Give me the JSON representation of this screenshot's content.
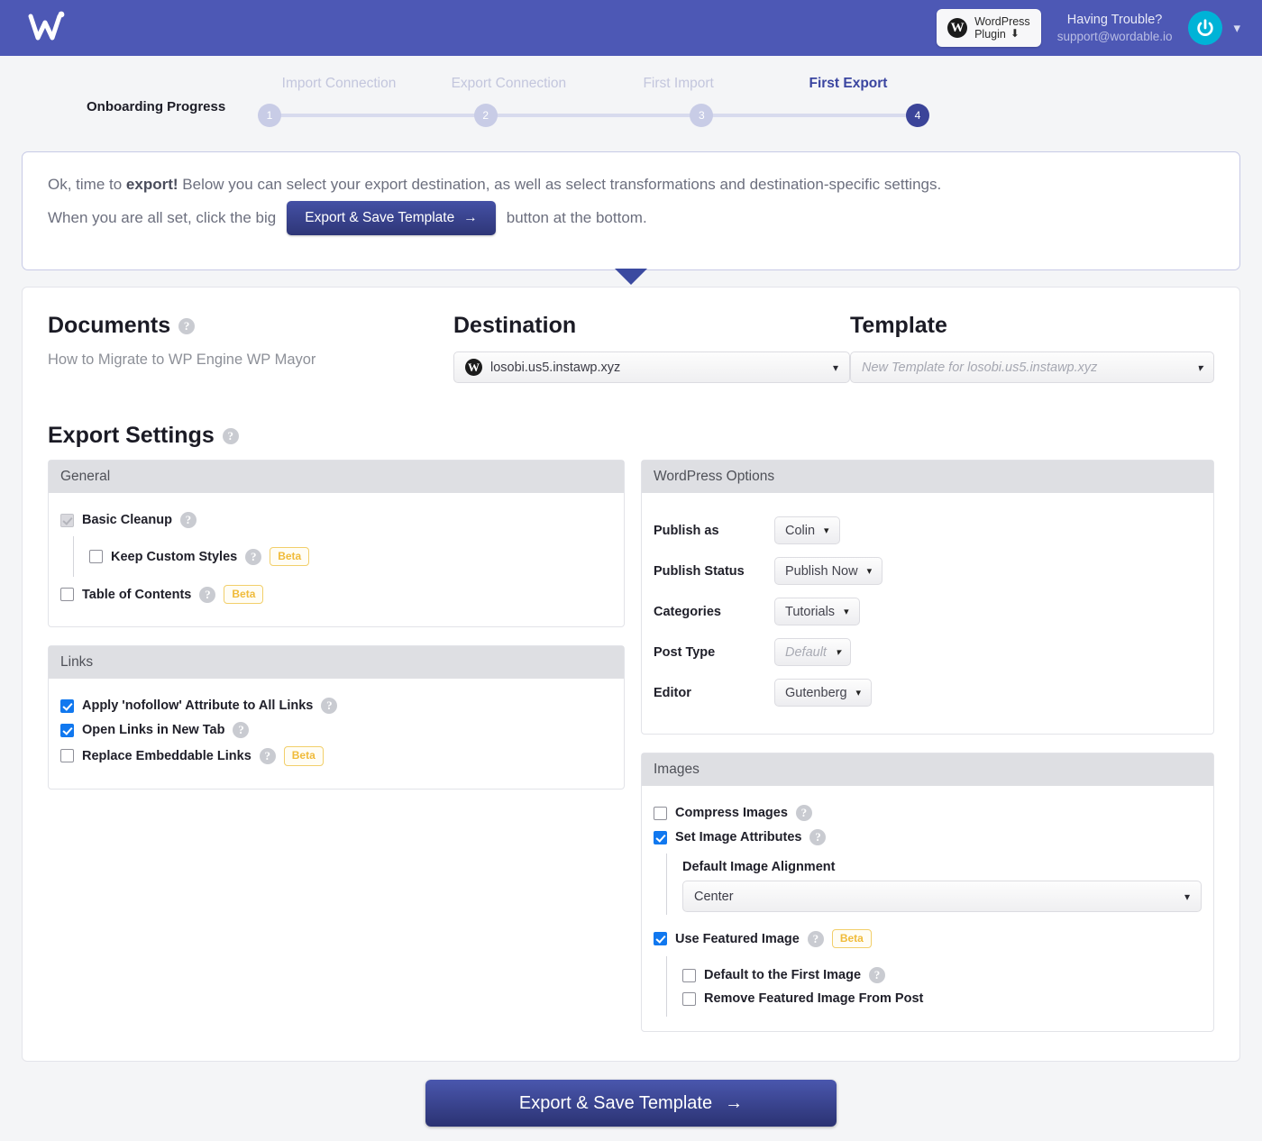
{
  "header": {
    "logo_alt": "Wordable logo",
    "wp_plugin_line1": "WordPress",
    "wp_plugin_line2": "Plugin",
    "download_icon": "download-icon",
    "trouble_title": "Having Trouble?",
    "trouble_email": "support@wordable.io",
    "avatar_icon": "power-icon",
    "caret_icon": "chevron-down-icon",
    "brand_color": "#4d58b5"
  },
  "progress": {
    "label": "Onboarding Progress",
    "steps": [
      {
        "label": "Import Connection",
        "number": "1",
        "active": false
      },
      {
        "label": "Export Connection",
        "number": "2",
        "active": false
      },
      {
        "label": "First Import",
        "number": "3",
        "active": false
      },
      {
        "label": "First Export",
        "number": "4",
        "active": true
      }
    ],
    "active_color": "#3b4499",
    "inactive_color": "#c8cce6"
  },
  "notice": {
    "line1_a": "Ok, time to",
    "line1_b": "export!",
    "line1_c": "Below you can select your export destination, as well as select transformations and destination-specific settings.",
    "line2_a": "When you are all set, click the big",
    "button_label": "Export & Save Template",
    "button_arrow": "→",
    "line2_b": "button at the bottom."
  },
  "documents": {
    "title": "Documents",
    "help_icon": "help-icon",
    "name": "How to Migrate to WP Engine WP Mayor"
  },
  "destination": {
    "title": "Destination",
    "value": "losobi.us5.instawp.xyz",
    "icon": "wordpress-icon",
    "chevron": "⌄"
  },
  "template": {
    "title": "Template",
    "placeholder": "New Template for losobi.us5.instawp.xyz",
    "chevron": "⌄"
  },
  "export_settings": {
    "title": "Export Settings",
    "help_icon": "help-icon",
    "general": {
      "heading": "General",
      "items": [
        {
          "label": "Basic Cleanup",
          "checked": true,
          "disabled": true,
          "help": true,
          "beta": false,
          "indent": false
        },
        {
          "label": "Keep Custom Styles",
          "checked": false,
          "disabled": false,
          "help": true,
          "beta": true,
          "indent": true
        },
        {
          "label": "Table of Contents",
          "checked": false,
          "disabled": false,
          "help": true,
          "beta": true,
          "indent": false
        }
      ]
    },
    "links": {
      "heading": "Links",
      "items": [
        {
          "label": "Apply 'nofollow' Attribute to All Links",
          "checked": true,
          "disabled": false,
          "help": true,
          "beta": false,
          "indent": false
        },
        {
          "label": "Open Links in New Tab",
          "checked": true,
          "disabled": false,
          "help": true,
          "beta": false,
          "indent": false
        },
        {
          "label": "Replace Embeddable Links",
          "checked": false,
          "disabled": false,
          "help": true,
          "beta": true,
          "indent": false
        }
      ]
    },
    "wordpress_options": {
      "heading": "WordPress Options",
      "rows": [
        {
          "label": "Publish as",
          "value": "Colin",
          "placeholder": false
        },
        {
          "label": "Publish Status",
          "value": "Publish Now",
          "placeholder": false
        },
        {
          "label": "Categories",
          "value": "Tutorials",
          "placeholder": false
        },
        {
          "label": "Post Type",
          "value": "Default",
          "placeholder": true
        },
        {
          "label": "Editor",
          "value": "Gutenberg",
          "placeholder": false
        }
      ]
    },
    "images": {
      "heading": "Images",
      "compress": {
        "label": "Compress Images",
        "checked": false,
        "help": true
      },
      "set_attributes": {
        "label": "Set Image Attributes",
        "checked": true,
        "help": true
      },
      "alignment_label": "Default Image Alignment",
      "alignment_value": "Center",
      "featured": {
        "label": "Use Featured Image",
        "checked": true,
        "help": true,
        "beta": true
      },
      "featured_children": [
        {
          "label": "Default to the First Image",
          "checked": false,
          "help": true
        },
        {
          "label": "Remove Featured Image From Post",
          "checked": false,
          "help": false
        }
      ]
    },
    "beta_label": "Beta"
  },
  "footer": {
    "button_label": "Export & Save Template",
    "button_arrow": "→"
  }
}
